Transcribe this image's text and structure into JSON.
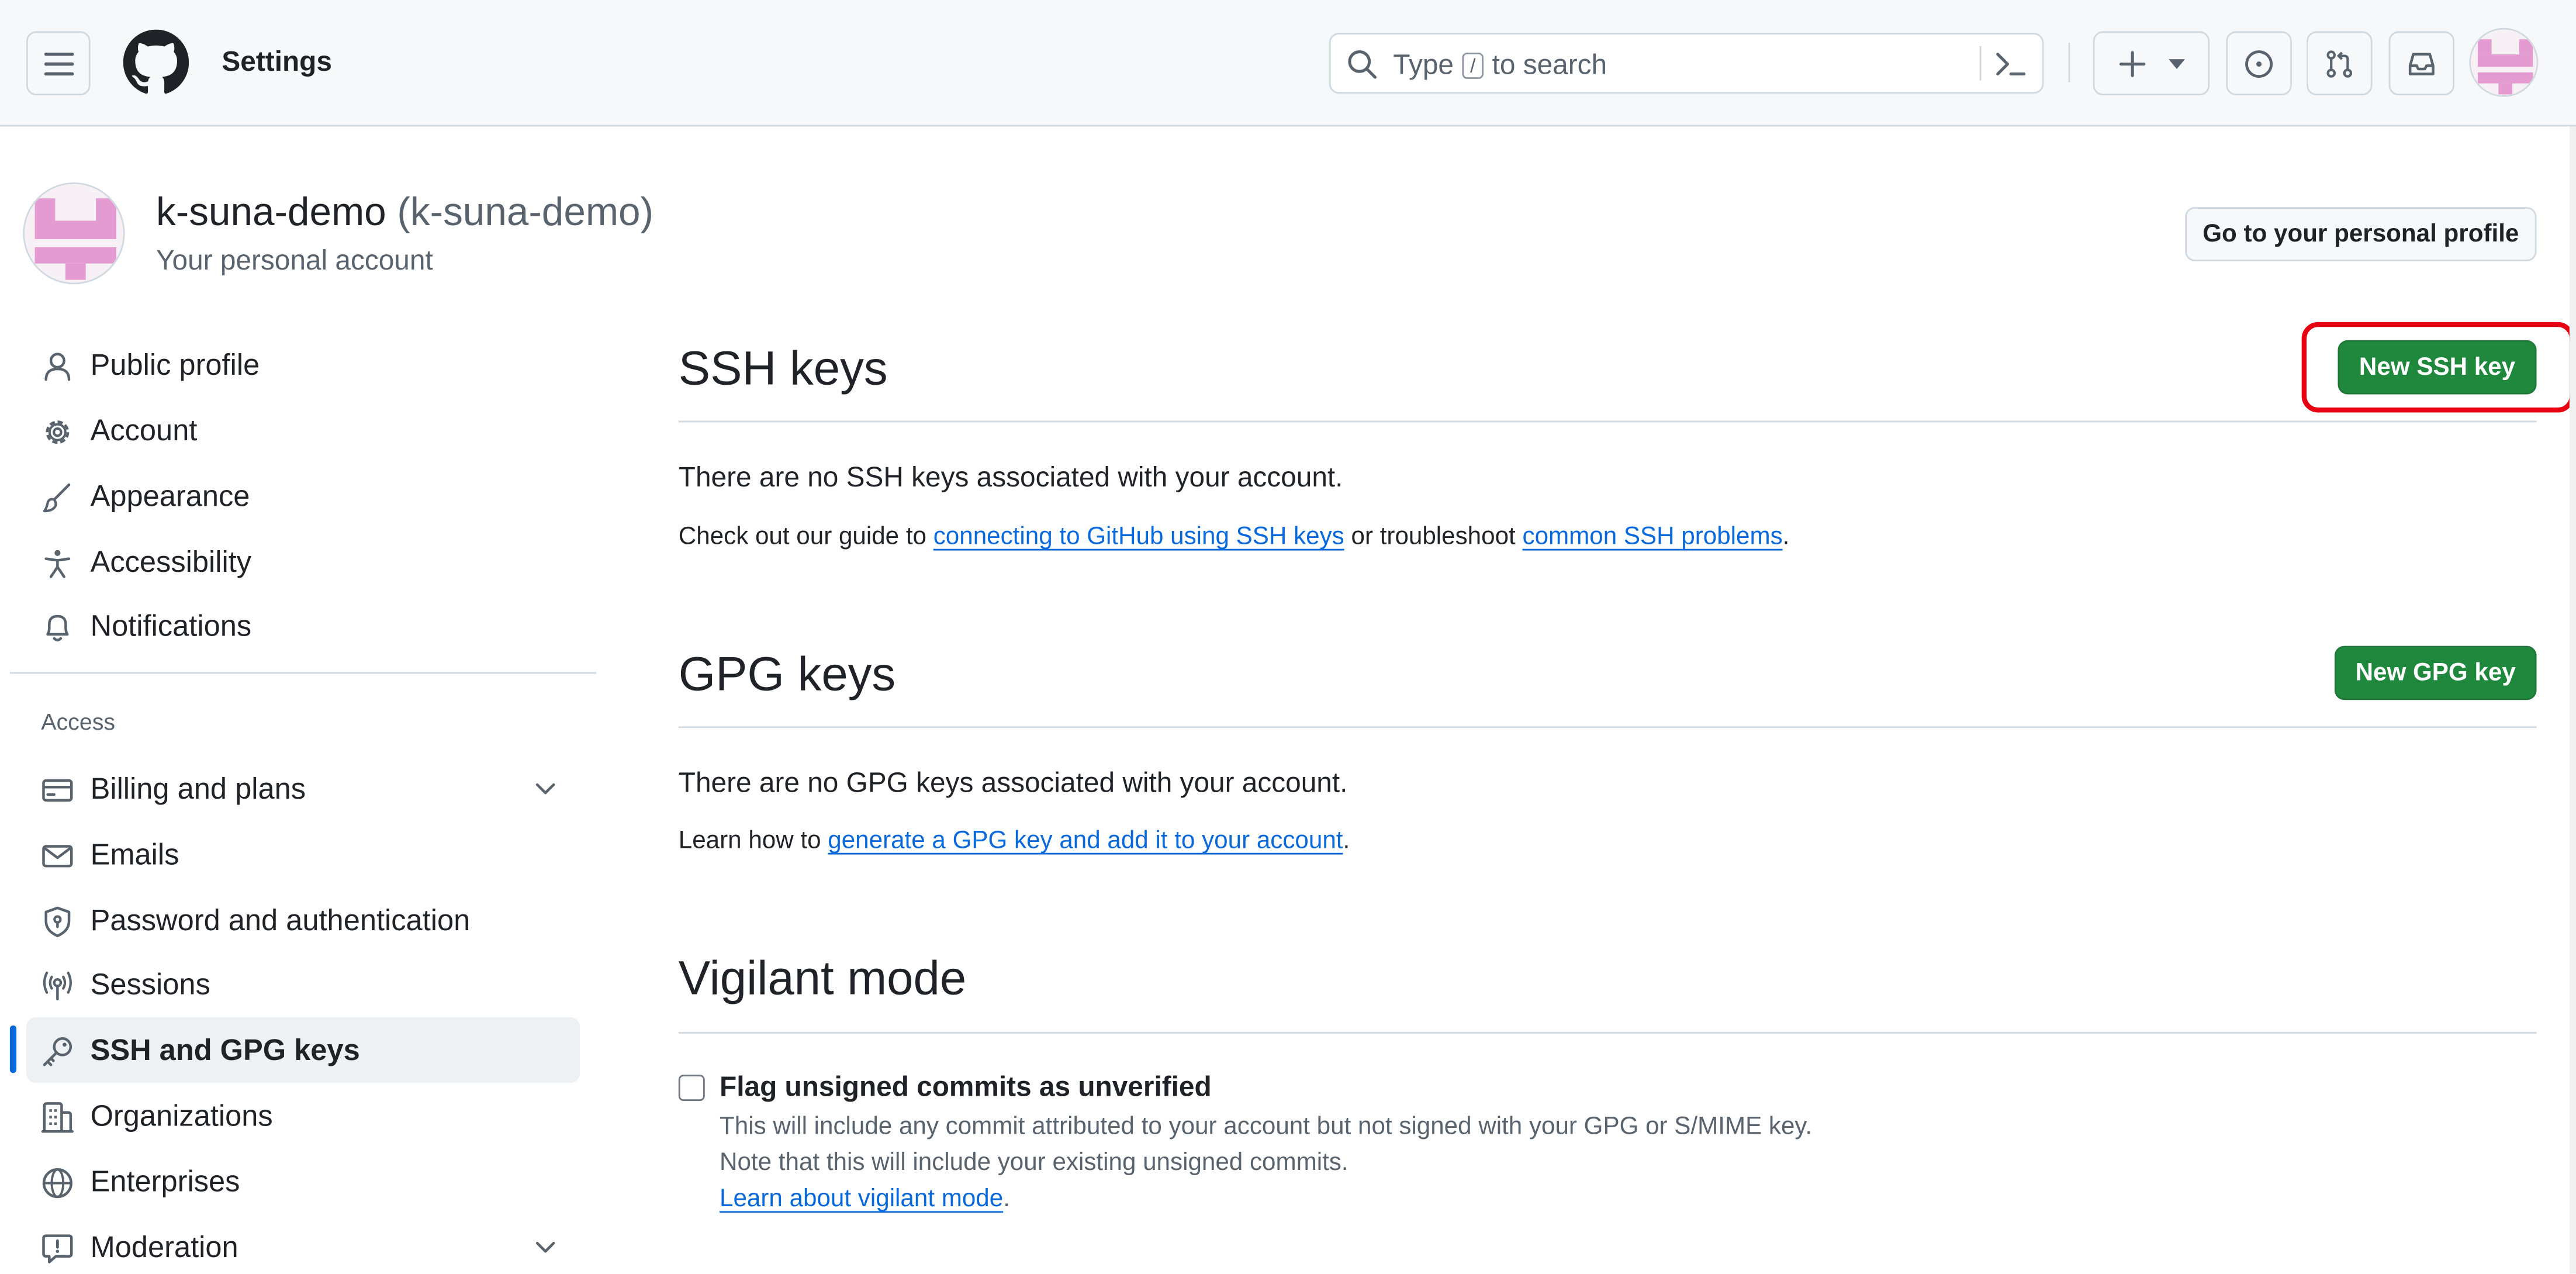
{
  "header": {
    "title": "Settings",
    "search_prefix": "Type",
    "search_key": "/",
    "search_suffix": "to search"
  },
  "account": {
    "name": "k-suna-demo",
    "login": "(k-suna-demo)",
    "subtitle": "Your personal account",
    "profile_button": "Go to your personal profile"
  },
  "sidebar": {
    "items": [
      {
        "label": "Public profile",
        "icon": "person-icon"
      },
      {
        "label": "Account",
        "icon": "gear-icon"
      },
      {
        "label": "Appearance",
        "icon": "paintbrush-icon"
      },
      {
        "label": "Accessibility",
        "icon": "accessibility-icon"
      },
      {
        "label": "Notifications",
        "icon": "bell-icon"
      }
    ],
    "group_label": "Access",
    "access_items": [
      {
        "label": "Billing and plans",
        "icon": "credit-card-icon"
      },
      {
        "label": "Emails",
        "icon": "mail-icon"
      },
      {
        "label": "Password and authentication",
        "icon": "shield-lock-icon"
      },
      {
        "label": "Sessions",
        "icon": "broadcast-icon"
      },
      {
        "label": "SSH and GPG keys",
        "icon": "key-icon"
      },
      {
        "label": "Organizations",
        "icon": "organization-icon"
      },
      {
        "label": "Enterprises",
        "icon": "globe-icon"
      },
      {
        "label": "Moderation",
        "icon": "report-icon"
      }
    ]
  },
  "ssh": {
    "title": "SSH keys",
    "button": "New SSH key",
    "empty": "There are no SSH keys associated with your account.",
    "guide_prefix": "Check out our guide to",
    "guide_link": "connecting to GitHub using SSH keys",
    "guide_middle": "or troubleshoot",
    "guide_link2": "common SSH problems",
    "guide_end": "."
  },
  "gpg": {
    "title": "GPG keys",
    "button": "New GPG key",
    "empty": "There are no GPG keys associated with your account.",
    "learn_prefix": "Learn how to",
    "learn_link": "generate a GPG key and add it to your account",
    "learn_end": "."
  },
  "vigilant": {
    "title": "Vigilant mode",
    "checkbox_label": "Flag unsigned commits as unverified",
    "note1": "This will include any commit attributed to your account but not signed with your GPG or S/MIME key.",
    "note2": "Note that this will include your existing unsigned commits.",
    "learn_link": "Learn about vigilant mode",
    "learn_end": "."
  },
  "colors": {
    "accent": "#0969da",
    "primary_button": "#1f883d",
    "highlight_box": "#e60012",
    "avatar_pink": "#e39bd1"
  }
}
